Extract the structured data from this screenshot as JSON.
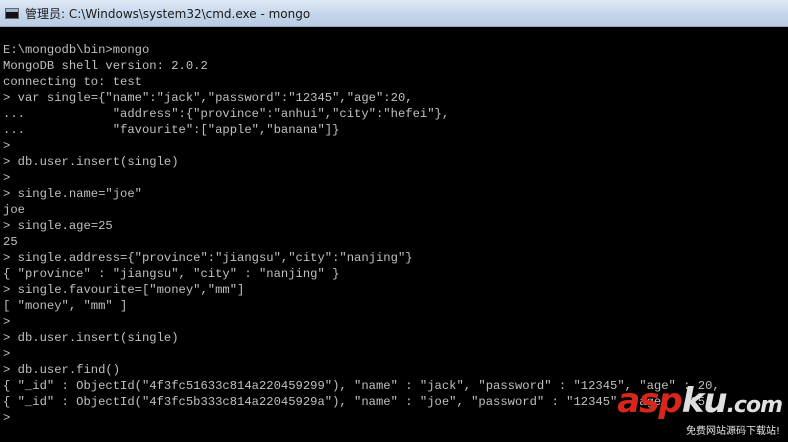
{
  "window": {
    "title": "管理员: C:\\Windows\\system32\\cmd.exe - mongo"
  },
  "console": {
    "lines": [
      "E:\\mongodb\\bin>mongo",
      "MongoDB shell version: 2.0.2",
      "connecting to: test",
      "> var single={\"name\":\"jack\",\"password\":\"12345\",\"age\":20,",
      "...            \"address\":{\"province\":\"anhui\",\"city\":\"hefei\"},",
      "...            \"favourite\":[\"apple\",\"banana\"]}",
      ">",
      "> db.user.insert(single)",
      ">",
      "> single.name=\"joe\"",
      "joe",
      "> single.age=25",
      "25",
      "> single.address={\"province\":\"jiangsu\",\"city\":\"nanjing\"}",
      "{ \"province\" : \"jiangsu\", \"city\" : \"nanjing\" }",
      "> single.favourite=[\"money\",\"mm\"]",
      "[ \"money\", \"mm\" ]",
      ">",
      "> db.user.insert(single)",
      ">",
      "> db.user.find()",
      "{ \"_id\" : ObjectId(\"4f3fc51633c814a220459299\"), \"name\" : \"jack\", \"password\" : \"12345\", \"age\" : 20,",
      "{ \"_id\" : ObjectId(\"4f3fc5b333c814a22045929a\"), \"name\" : \"joe\", \"password\" : \"12345\", \"age\" : 25,",
      ">"
    ]
  },
  "watermark": {
    "logo_red": "asp",
    "logo_white": "ku",
    "logo_tld": ".com",
    "subtitle": "免费网站源码下载站!"
  },
  "colors": {
    "console_bg": "#000000",
    "console_text": "#c0c0c0",
    "watermark_red": "#d9261c"
  }
}
